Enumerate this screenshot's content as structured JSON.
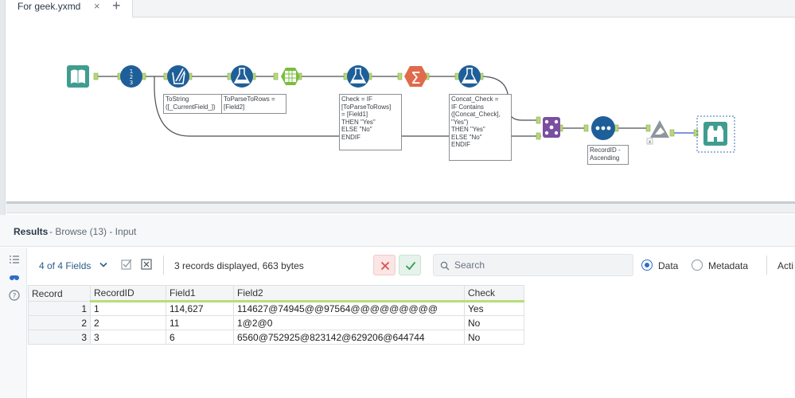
{
  "tab": {
    "title": "For geek.yxmd",
    "close_glyph": "×",
    "new_tab_glyph": "+"
  },
  "canvas": {
    "annotations": {
      "formula1": "ToString\n([_CurrentField_])",
      "formula2": "ToParseToRows =\n[Field2]",
      "formula3": "Check = IF\n[ToParseToRows]\n= [Field1]\nTHEN \"Yes\"\nELSE \"No\"\nENDIF",
      "formula4": "Concat_Check =\nIF Contains\n([Concat_Check],\n\"Yes\")\nTHEN \"Yes\"\nELSE \"No\"\nENDIF",
      "sort": "RecordID -\nAscending"
    },
    "colors": {
      "input_tool": "#3f9d8f",
      "blue_tool": "#1f5f99",
      "green_tool": "#7bbd3d",
      "summarize_tool": "#e06a4c",
      "join_tool": "#7a4fa0",
      "browse_tool": "#3f9d8f"
    }
  },
  "results": {
    "title": "Results",
    "subtitle": " - Browse (13) - Input"
  },
  "toolbar": {
    "fields_count": "4 of 4 Fields",
    "records_text": "3 records displayed, 663 bytes",
    "search_placeholder": "Search",
    "data_label": "Data",
    "metadata_label": "Metadata",
    "actions_label": "Acti"
  },
  "table": {
    "headers": [
      "Record",
      "RecordID",
      "Field1",
      "Field2",
      "Check"
    ],
    "rows": [
      [
        "1",
        "1",
        "114,627",
        "114627@74945@@97564@@@@@@@@@",
        "Yes"
      ],
      [
        "2",
        "2",
        "11",
        "1@2@0",
        "No"
      ],
      [
        "3",
        "3",
        "6",
        "6560@752925@823142@629206@644744",
        "No"
      ]
    ]
  }
}
